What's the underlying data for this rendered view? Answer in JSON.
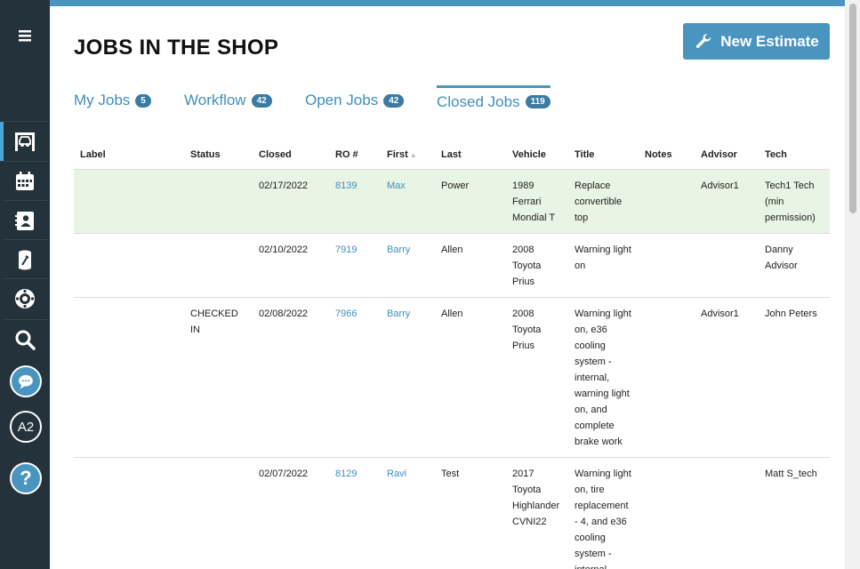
{
  "page": {
    "title": "JOBS IN THE SHOP",
    "new_estimate_label": "New Estimate"
  },
  "tabs": [
    {
      "label": "My Jobs",
      "count": "5"
    },
    {
      "label": "Workflow",
      "count": "42"
    },
    {
      "label": "Open Jobs",
      "count": "42"
    },
    {
      "label": "Closed Jobs",
      "count": "119"
    }
  ],
  "sidebar": {
    "a2_label": "A2",
    "help_label": "?"
  },
  "table": {
    "headers": [
      "Label",
      "Status",
      "Closed",
      "RO #",
      "First",
      "Last",
      "Vehicle",
      "Title",
      "Notes",
      "Advisor",
      "Tech"
    ],
    "rows": [
      {
        "label": "",
        "status": "",
        "closed": "02/17/2022",
        "ro": "8139",
        "first": "Max",
        "last": "Power",
        "vehicle": [
          "1989",
          "Ferrari",
          "Mondial T"
        ],
        "title": [
          "Replace",
          "convertible",
          "top"
        ],
        "notes": "",
        "advisor": "Advisor1",
        "tech": [
          "Tech1 Tech",
          "(min",
          "permission)"
        ]
      },
      {
        "label": "",
        "status": "",
        "closed": "02/10/2022",
        "ro": "7919",
        "first": "Barry",
        "last": "Allen",
        "vehicle": [
          "2008",
          "Toyota",
          "Prius"
        ],
        "title": [
          "Warning light",
          "on"
        ],
        "notes": "",
        "advisor": "",
        "tech": [
          "Danny",
          "Advisor"
        ]
      },
      {
        "label": "",
        "status": [
          "CHECKED",
          "IN"
        ],
        "closed": "02/08/2022",
        "ro": "7966",
        "first": "Barry",
        "last": "Allen",
        "vehicle": [
          "2008",
          "Toyota",
          "Prius"
        ],
        "title": [
          "Warning light",
          "on, e36",
          "cooling",
          "system -",
          "internal,",
          "warning light",
          "on, and",
          "complete",
          "brake work"
        ],
        "notes": "",
        "advisor": "Advisor1",
        "tech": [
          "John Peters"
        ]
      },
      {
        "label": "",
        "status": "",
        "closed": "02/07/2022",
        "ro": "8129",
        "first": "Ravi",
        "last": "Test",
        "vehicle": [
          "2017",
          "Toyota",
          "Highlander",
          "CVNI22"
        ],
        "title": [
          "Warning light",
          "on, tire",
          "replacement",
          "- 4, and e36",
          "cooling",
          "system -",
          "internal"
        ],
        "notes": "",
        "advisor": "",
        "tech": [
          "Matt S_tech"
        ]
      }
    ]
  },
  "colors": {
    "accent": "#4a95c0",
    "sidebar": "#24323c",
    "highlight_row": "#e8f4e4",
    "badge": "#3a7aa3"
  }
}
